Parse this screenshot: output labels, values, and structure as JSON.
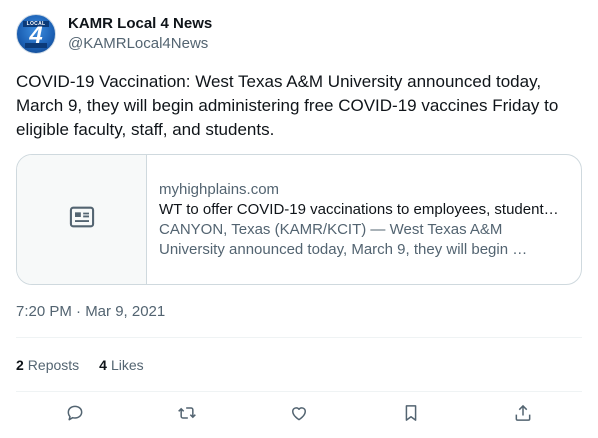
{
  "account": {
    "display_name": "KAMR Local 4 News",
    "handle": "@KAMRLocal4News",
    "avatar": {
      "top_text": "LOCAL",
      "number": "4"
    }
  },
  "tweet": {
    "text": "COVID-19 Vaccination: West Texas A&M University announced today, March 9, they will begin administering free COVID-19 vaccines Friday to eligible faculty, staff, and students."
  },
  "link_card": {
    "icon": "article-icon",
    "domain": "myhighplains.com",
    "title": "WT to offer COVID-19 vaccinations to employees, student…",
    "description": "CANYON, Texas (KAMR/KCIT) — West Texas A&M University announced today, March 9, they will begin …"
  },
  "timestamp": "7:20 PM · Mar 9, 2021",
  "stats": {
    "reposts_count": "2",
    "reposts_label": "Reposts",
    "likes_count": "4",
    "likes_label": "Likes"
  },
  "actions": [
    "reply-icon",
    "repost-icon",
    "like-icon",
    "bookmark-icon",
    "share-icon"
  ],
  "colors": {
    "text_primary": "#0f1419",
    "text_secondary": "#536471",
    "border": "#cfd9de",
    "divider": "#eff3f4",
    "brand_blue": "#1b5fb3"
  }
}
